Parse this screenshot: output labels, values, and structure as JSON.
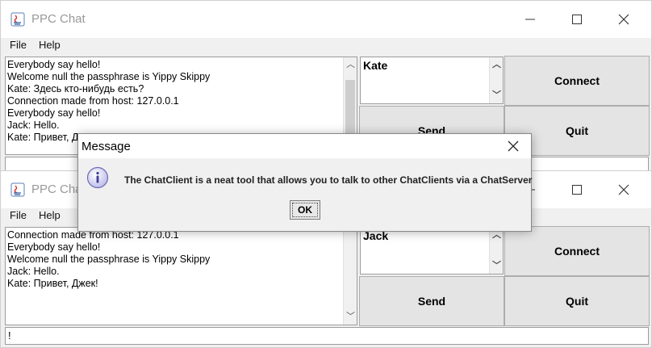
{
  "window_back": {
    "title": "PPC Chat",
    "menu": [
      "File",
      "Help"
    ],
    "chat_lines": [
      "Everybody say hello!",
      "Welcome null the passphrase is Yippy Skippy",
      "Kate: Здесь кто-нибудь есть?",
      "Connection made from host: 127.0.0.1",
      "Everybody say hello!",
      "Jack: Hello.",
      "Kate: Привет, Джек!"
    ],
    "name": "Kate",
    "buttons": {
      "connect": "Connect",
      "send": "Send",
      "quit": "Quit"
    },
    "input_value": ""
  },
  "window_front": {
    "title": "PPC Chat",
    "menu": [
      "File",
      "Help"
    ],
    "chat_lines": [
      "Connection made from host: 127.0.0.1",
      "Everybody say hello!",
      "Welcome null the passphrase is Yippy Skippy",
      "Jack: Hello.",
      "Kate: Привет, Джек!"
    ],
    "name": "Jack",
    "buttons": {
      "connect": "Connect",
      "send": "Send",
      "quit": "Quit"
    },
    "input_value": "!"
  },
  "dialog": {
    "title": "Message",
    "message": "The ChatClient is a neat tool that allows you to talk to other ChatClients via a ChatServer",
    "ok_label": "OK",
    "icon": "info-icon"
  }
}
